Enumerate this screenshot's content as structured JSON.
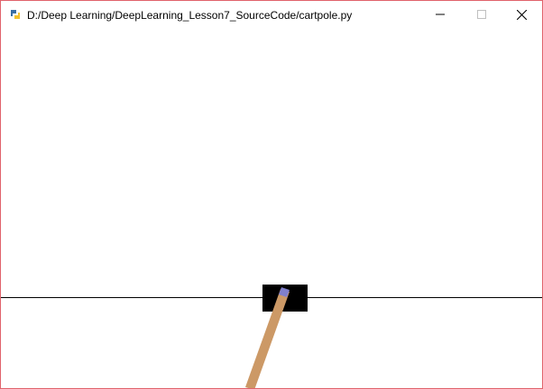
{
  "window": {
    "title": "D:/Deep Learning/DeepLearning_Lesson7_SourceCode/cartpole.py",
    "border_color": "#e0636b"
  },
  "titlebar_buttons": {
    "minimize_icon": "minimize-icon",
    "maximize_icon": "maximize-icon",
    "close_icon": "close-icon"
  },
  "scene": {
    "background": "#ffffff",
    "track_color": "#000000",
    "cart_color": "#000000",
    "pole_color": "#cc9966",
    "axle_color": "#8080cc"
  }
}
